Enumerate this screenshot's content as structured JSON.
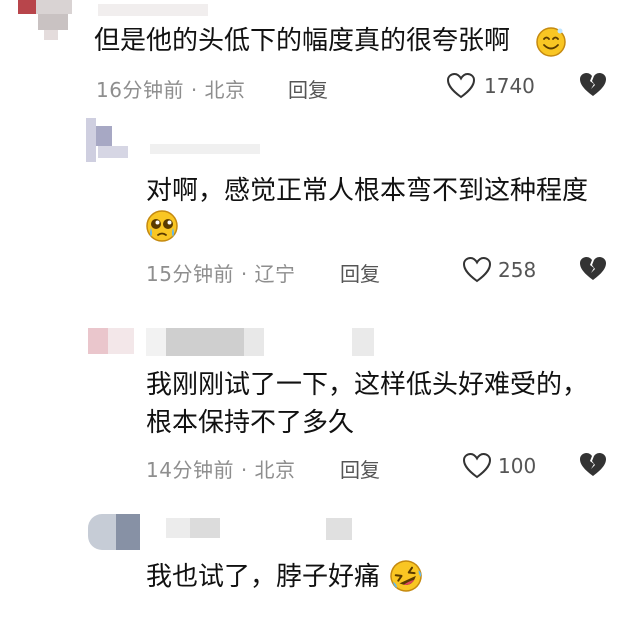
{
  "comments": [
    {
      "text": "但是他的头低下的幅度真的很夸张啊",
      "emoji": "smiling-face-emoji",
      "time": "16分钟前",
      "location": "北京",
      "reply_label": "回复",
      "likes": "1740"
    },
    {
      "text": "对啊，感觉正常人根本弯不到这种程度",
      "emoji": "pleading-face-emoji",
      "time": "15分钟前",
      "location": "辽宁",
      "reply_label": "回复",
      "likes": "258"
    },
    {
      "text_line1": "我刚刚试了一下，这样低头好难受的，",
      "text_line2": "根本保持不了多久",
      "time": "14分钟前",
      "location": "北京",
      "reply_label": "回复",
      "likes": "100"
    },
    {
      "text": "我也试了，脖子好痛",
      "emoji": "rolling-laughing-emoji"
    }
  ],
  "separator": "·",
  "colors": {
    "meta_text": "#8e8e8e",
    "body_text": "#111111",
    "emoji_yellow": "#f9c623"
  }
}
